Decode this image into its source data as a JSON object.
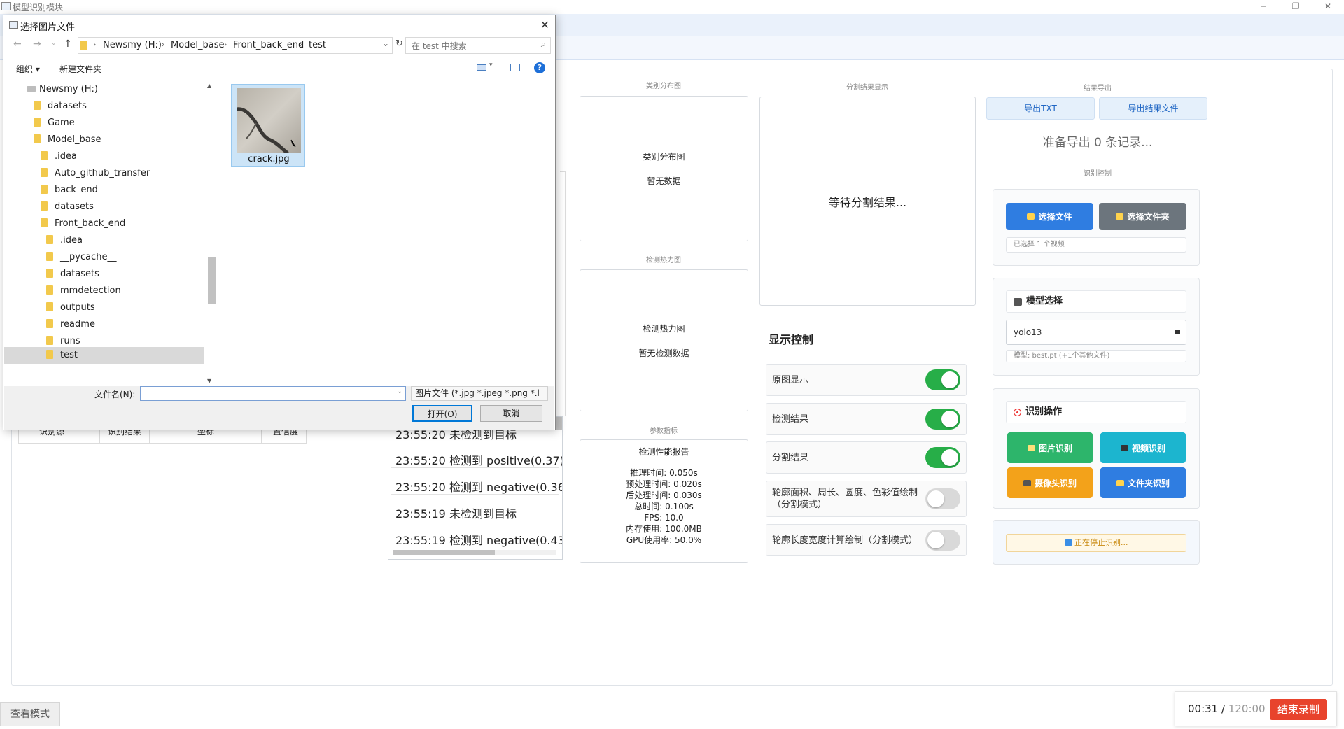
{
  "window": {
    "title": "模型识别模块",
    "min_glyph": "─",
    "max_glyph": "❐",
    "close_glyph": "✕"
  },
  "dialog": {
    "title": "选择图片文件",
    "close_glyph": "✕",
    "breadcrumb": [
      "Newsmy (H:)",
      "Model_base",
      "Front_back_end",
      "test"
    ],
    "search_placeholder": "在 test 中搜索",
    "organize_label": "组织 ▾",
    "new_folder_label": "新建文件夹",
    "help_glyph": "?",
    "tree": [
      {
        "label": "Newsmy (H:)",
        "type": "drive"
      },
      {
        "label": "datasets",
        "type": "folder"
      },
      {
        "label": "Game",
        "type": "folder"
      },
      {
        "label": "Model_base",
        "type": "folder"
      },
      {
        "label": ".idea",
        "type": "folder"
      },
      {
        "label": "Auto_github_transfer",
        "type": "folder"
      },
      {
        "label": "back_end",
        "type": "folder"
      },
      {
        "label": "datasets",
        "type": "folder"
      },
      {
        "label": "Front_back_end",
        "type": "folder"
      },
      {
        "label": ".idea",
        "type": "folder"
      },
      {
        "label": "__pycache__",
        "type": "folder"
      },
      {
        "label": "datasets",
        "type": "folder"
      },
      {
        "label": "mmdetection",
        "type": "folder"
      },
      {
        "label": "outputs",
        "type": "folder"
      },
      {
        "label": "readme",
        "type": "folder"
      },
      {
        "label": "runs",
        "type": "folder"
      },
      {
        "label": "test",
        "type": "folder"
      }
    ],
    "selected_tree_item": "test",
    "file": {
      "name": "crack.jpg"
    },
    "filename_label": "文件名(N):",
    "filename_value": "",
    "filetype_value": "图片文件 (*.jpg *.jpeg *.png *.l",
    "open_button": "打开(O)",
    "cancel_button": "取消"
  },
  "category_panel": {
    "caption": "类别分布图",
    "title": "类别分布图",
    "empty": "暂无数据"
  },
  "heatmap_panel": {
    "caption": "检测热力图",
    "title": "检测热力图",
    "empty": "暂无检测数据"
  },
  "metrics_panel": {
    "caption": "参数指标",
    "title": "检测性能报告",
    "lines": [
      "推理时间: 0.050s",
      "预处理时间: 0.020s",
      "后处理时间: 0.030s",
      "总时间: 0.100s",
      "FPS: 10.0",
      "内存使用: 100.0MB",
      "GPU使用率: 50.0%"
    ]
  },
  "segmentation_panel": {
    "caption": "分割结果显示",
    "placeholder": "等待分割结果..."
  },
  "display_control": {
    "title": "显示控制",
    "toggles": [
      {
        "label": "原图显示",
        "on": true
      },
      {
        "label": "检测结果",
        "on": true
      },
      {
        "label": "分割结果",
        "on": true
      },
      {
        "label": "轮廓面积、周长、圆度、色彩值绘制\n（分割模式）",
        "on": false
      },
      {
        "label": "轮廓长度宽度计算绘制（分割模式）",
        "on": false
      }
    ]
  },
  "export": {
    "caption": "结果导出",
    "txt_button": "导出TXT",
    "file_button": "导出结果文件",
    "message": "准备导出 0 条记录..."
  },
  "recognition_control": {
    "caption": "识别控制",
    "select_file": "选择文件",
    "select_folder": "选择文件夹",
    "selected_info": "已选择 1 个视频"
  },
  "model_select": {
    "header": "模型选择",
    "value": "yolo13",
    "info": "模型: best.pt (+1个其他文件)"
  },
  "recognition_ops": {
    "header": "识别操作",
    "image": "图片识别",
    "video": "视频识别",
    "camera": "摄像头识别",
    "folder": "文件夹识别",
    "status": "正在停止识别..."
  },
  "result_table": {
    "headers": [
      "识别源",
      "识别结果",
      "坐标",
      "置信度"
    ]
  },
  "log": [
    "23:55:20 未检测到目标",
    "23:55:20 检测到 positive(0.37)",
    "23:55:20 检测到 negative(0.36",
    "23:55:19 未检测到目标",
    "23:55:19 检测到 negative(0.43"
  ],
  "bottom": {
    "view_mode": "查看模式",
    "elapsed": "00:31",
    "separator": " / ",
    "total": "120:00",
    "stop_record": "结束录制"
  },
  "colors": {
    "accent_blue": "#2f7de1",
    "toggle_on": "#27ae48",
    "record_red": "#e8432c"
  }
}
